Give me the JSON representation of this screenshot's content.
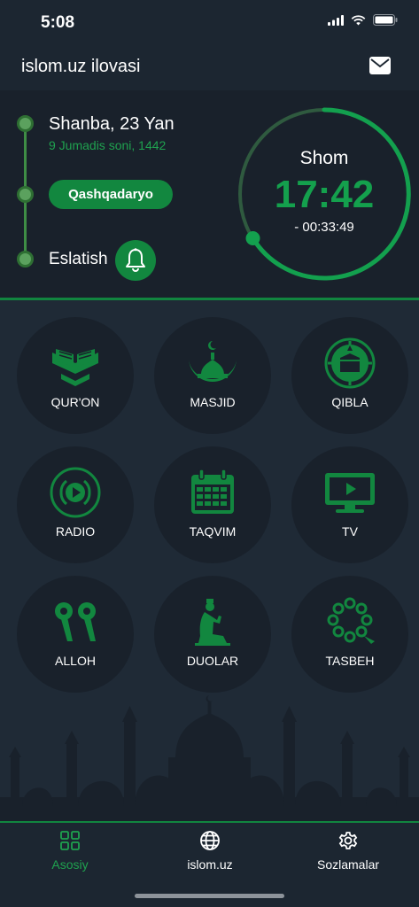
{
  "status": {
    "time": "5:08"
  },
  "header": {
    "title": "islom.uz ilovasi"
  },
  "prayer": {
    "date": "Shanba, 23 Yan",
    "hijri_date": "9 Jumadis soni, 1442",
    "region": "Qashqadaryo",
    "remind_label": "Eslatish",
    "current_name": "Shom",
    "current_time": "17:42",
    "countdown": "- 00:33:49"
  },
  "menu": [
    {
      "label": "QUR'ON",
      "icon": "quran-icon"
    },
    {
      "label": "MASJID",
      "icon": "mosque-icon"
    },
    {
      "label": "QIBLA",
      "icon": "qibla-compass-icon"
    },
    {
      "label": "RADIO",
      "icon": "radio-icon"
    },
    {
      "label": "TAQVIM",
      "icon": "calendar-icon"
    },
    {
      "label": "TV",
      "icon": "tv-icon"
    },
    {
      "label": "ALLOH",
      "icon": "ninety-nine-names-icon"
    },
    {
      "label": "DUOLAR",
      "icon": "praying-man-icon"
    },
    {
      "label": "TASBEH",
      "icon": "tasbeh-beads-icon"
    }
  ],
  "tabs": [
    {
      "label": "Asosiy",
      "icon": "grid-icon",
      "active": true
    },
    {
      "label": "islom.uz",
      "icon": "globe-icon",
      "active": false
    },
    {
      "label": "Sozlamalar",
      "icon": "gear-icon",
      "active": false
    }
  ],
  "colors": {
    "accent": "#12873f",
    "accent_text": "#1fa24f",
    "background": "#1f2a36",
    "panel": "#19212b"
  }
}
